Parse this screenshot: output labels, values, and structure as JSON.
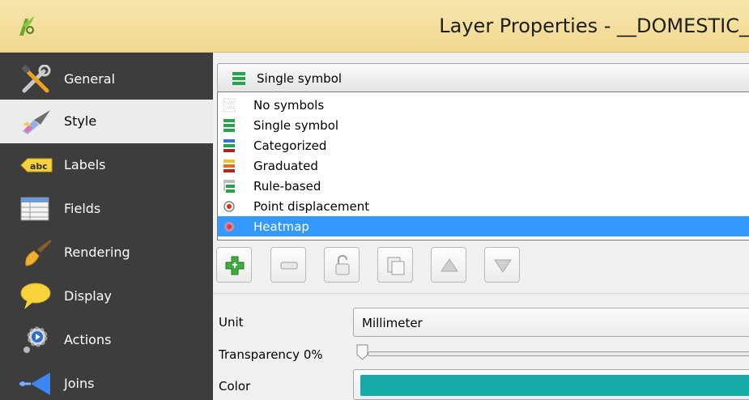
{
  "window": {
    "title": "Layer Properties - __DOMESTIC_"
  },
  "sidebar": {
    "items": [
      {
        "label": "General",
        "icon": "tools-icon"
      },
      {
        "label": "Style",
        "icon": "paintbrush-icon",
        "active": true
      },
      {
        "label": "Labels",
        "icon": "abc-label-icon",
        "icon_text": "abc"
      },
      {
        "label": "Fields",
        "icon": "table-icon"
      },
      {
        "label": "Rendering",
        "icon": "brush-icon"
      },
      {
        "label": "Display",
        "icon": "speech-bubble-icon"
      },
      {
        "label": "Actions",
        "icon": "gear-icon"
      },
      {
        "label": "Joins",
        "icon": "join-arrow-icon"
      }
    ]
  },
  "renderer": {
    "selected": "Single symbol",
    "options": [
      {
        "label": "No symbols",
        "icon": "no-symbols-icon"
      },
      {
        "label": "Single symbol",
        "icon": "single-symbol-icon"
      },
      {
        "label": "Categorized",
        "icon": "categorized-icon"
      },
      {
        "label": "Graduated",
        "icon": "graduated-icon"
      },
      {
        "label": "Rule-based",
        "icon": "rule-based-icon"
      },
      {
        "label": "Point displacement",
        "icon": "point-displacement-icon"
      },
      {
        "label": "Heatmap",
        "icon": "heatmap-icon",
        "highlighted": true
      }
    ]
  },
  "toolbar": {
    "buttons": [
      "add-symbol-layer-button",
      "remove-symbol-layer-button",
      "lock-layer-button",
      "duplicate-layer-button",
      "move-up-button",
      "move-down-button"
    ]
  },
  "form": {
    "unit_label": "Unit",
    "unit_value": "Millimeter",
    "transparency_label": "Transparency 0%",
    "transparency_value": 0,
    "color_label": "Color",
    "color_value": "#16a9a6"
  },
  "colors": {
    "titlebar": "#f4dc98",
    "sidebar_bg": "#3d3d3d",
    "selection": "#3399ff"
  }
}
